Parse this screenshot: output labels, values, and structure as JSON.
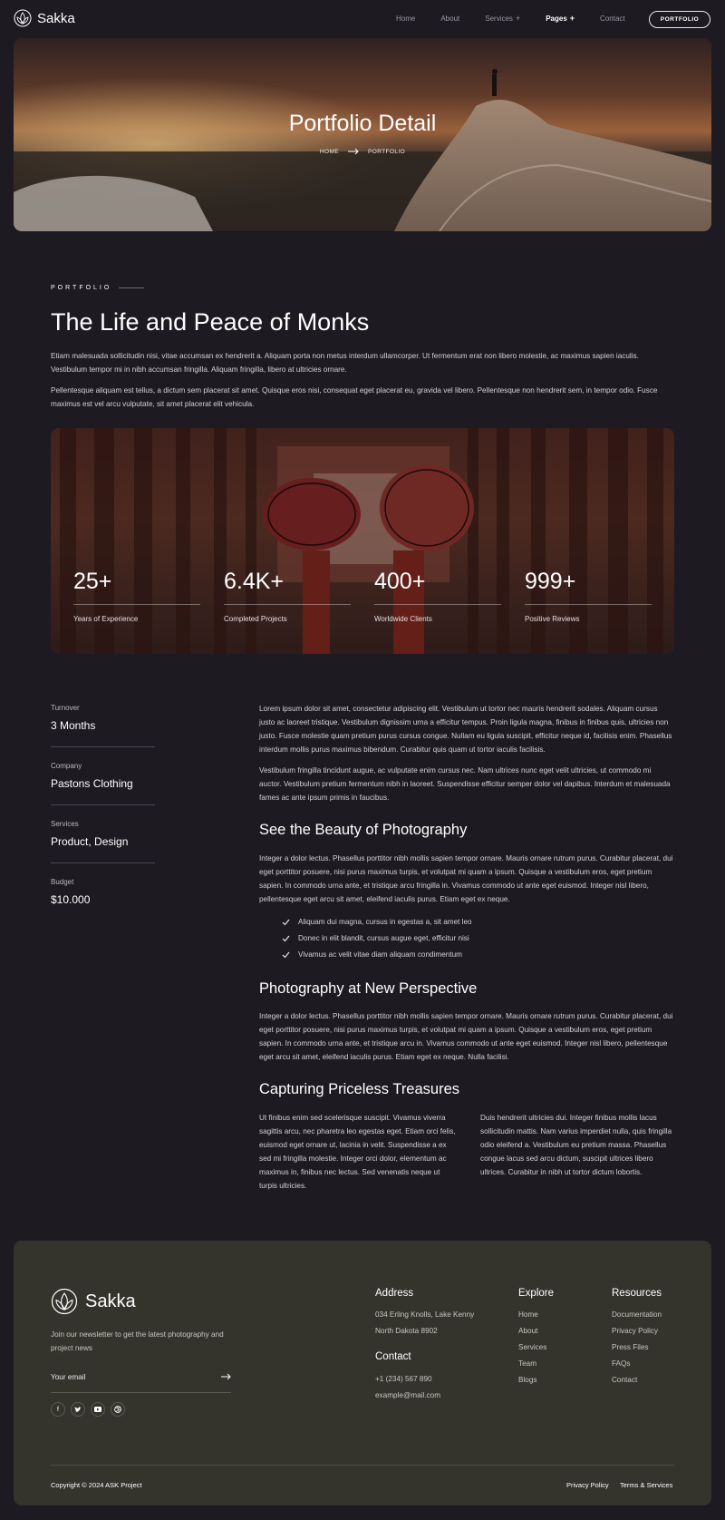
{
  "nav": {
    "brand": "Sakka",
    "links": [
      "Home",
      "About",
      "Services",
      "Pages",
      "Contact"
    ],
    "cta": "PORTFOLIO"
  },
  "hero": {
    "title": "Portfolio Detail",
    "crumb_home": "HOME",
    "crumb_current": "PORTFOLIO"
  },
  "intro": {
    "eyebrow": "PORTFOLIO",
    "title": "The Life and Peace of Monks",
    "p1": "Etiam malesuada sollicitudin nisi, vitae accumsan ex hendrerit a. Aliquam porta non metus interdum ullamcorper. Ut fermentum erat non libero molestie, ac maximus sapien iaculis. Vestibulum tempor mi in nibh accumsan fringilla. Aliquam fringilla, libero at ultricies ornare.",
    "p2": "Pellentesque aliquam est tellus, a dictum sem placerat sit amet. Quisque eros nisi, consequat eget placerat eu, gravida vel libero. Pellentesque non hendrerit sem, in tempor odio. Fusce maximus est vel arcu vulputate, sit amet placerat elit vehicula."
  },
  "stats": [
    {
      "value": "25+",
      "label": "Years of Experience"
    },
    {
      "value": "6.4K+",
      "label": "Completed Projects"
    },
    {
      "value": "400+",
      "label": "Worldwide Clients"
    },
    {
      "value": "999+",
      "label": "Positive Reviews"
    }
  ],
  "info": [
    {
      "label": "Turnover",
      "value": "3 Months"
    },
    {
      "label": "Company",
      "value": "Pastons Clothing"
    },
    {
      "label": "Services",
      "value": "Product, Design"
    },
    {
      "label": "Budget",
      "value": "$10.000"
    }
  ],
  "content": {
    "p1": "Lorem ipsum dolor sit amet, consectetur adipiscing elit. Vestibulum ut tortor nec mauris hendrerit sodales. Aliquam cursus justo ac laoreet tristique. Vestibulum dignissim urna a efficitur tempus. Proin ligula magna, finibus in finibus quis, ultricies non justo. Fusce molestie quam pretium purus cursus congue. Nullam eu ligula suscipit, efficitur neque id, facilisis enim. Phasellus interdum mollis purus maximus bibendum. Curabitur quis quam ut tortor iaculis facilisis.",
    "p2": "Vestibulum fringilla tincidunt augue, ac vulputate enim cursus nec. Nam ultrices nunc eget velit ultricies, ut commodo mi auctor. Vestibulum pretium fermentum nibh in laoreet. Suspendisse efficitur semper dolor vel dapibus. Interdum et malesuada fames ac ante ipsum primis in faucibus.",
    "h1": "See the Beauty of Photography",
    "p3": "Integer a dolor lectus. Phasellus porttitor nibh mollis sapien tempor ornare. Mauris ornare rutrum purus. Curabitur placerat, dui eget porttitor posuere, nisi purus maximus turpis, et volutpat mi quam a ipsum. Quisque a vestibulum eros, eget pretium sapien. In commodo urna ante, et tristique arcu fringilla in. Vivamus commodo ut ante eget euismod. Integer nisl libero, pellentesque eget arcu sit amet, eleifend iaculis purus. Etiam eget ex neque.",
    "checks": [
      "Aliquam dui magna, cursus in egestas a, sit amet leo",
      "Donec in elit blandit, cursus augue eget, efficitur nisi",
      "Vivamus ac velit vitae diam aliquam condimentum"
    ],
    "h2": "Photography at New Perspective",
    "p4": "Integer a dolor lectus. Phasellus porttitor nibh mollis sapien tempor ornare. Mauris ornare rutrum purus. Curabitur placerat, dui eget porttitor posuere, nisi purus maximus turpis, et volutpat mi quam a ipsum. Quisque a vestibulum eros, eget pretium sapien. In commodo urna ante, et tristique arcu in. Vivamus commodo ut ante eget euismod. Integer nisl libero, pellentesque eget arcu sit amet, eleifend iaculis purus. Etiam eget ex neque. Nulla facilisi.",
    "h3": "Capturing Priceless Treasures",
    "col1": "Ut finibus enim sed scelerisque suscipit. Vivamus viverra sagittis arcu, nec pharetra leo egestas eget. Etiam orci felis, euismod eget ornare ut, lacinia in velit. Suspendisse a ex sed mi fringilla molestie. Integer orci dolor, elementum ac maximus in, finibus nec lectus. Sed venenatis neque ut turpis ultricies.",
    "col2": "Duis hendrerit ultricies dui. Integer finibus mollis lacus sollicitudin mattis. Nam varius imperdiet nulla, quis fringilla odio eleifend a. Vestibulum eu pretium massa. Phasellus congue lacus sed arcu dictum, suscipit ultrices libero ultrices. Curabitur in nibh ut tortor dictum lobortis."
  },
  "footer": {
    "brand": "Sakka",
    "newsletter": "Join our newsletter to get the latest photography and project news",
    "email_placeholder": "Your email",
    "address_title": "Address",
    "address_line1": "034 Erling Knolls, Lake Kenny",
    "address_line2": "North Dakota 8902",
    "contact_title": "Contact",
    "phone": "+1 (234) 567 890",
    "email": "example@mail.com",
    "explore_title": "Explore",
    "explore": [
      "Home",
      "About",
      "Services",
      "Team",
      "Blogs"
    ],
    "resources_title": "Resources",
    "resources": [
      "Documentation",
      "Privacy Policy",
      "Press Files",
      "FAQs",
      "Contact"
    ],
    "copyright": "Copyright © 2024 ASK Project",
    "privacy": "Privacy Policy",
    "terms": "Terms & Services"
  }
}
